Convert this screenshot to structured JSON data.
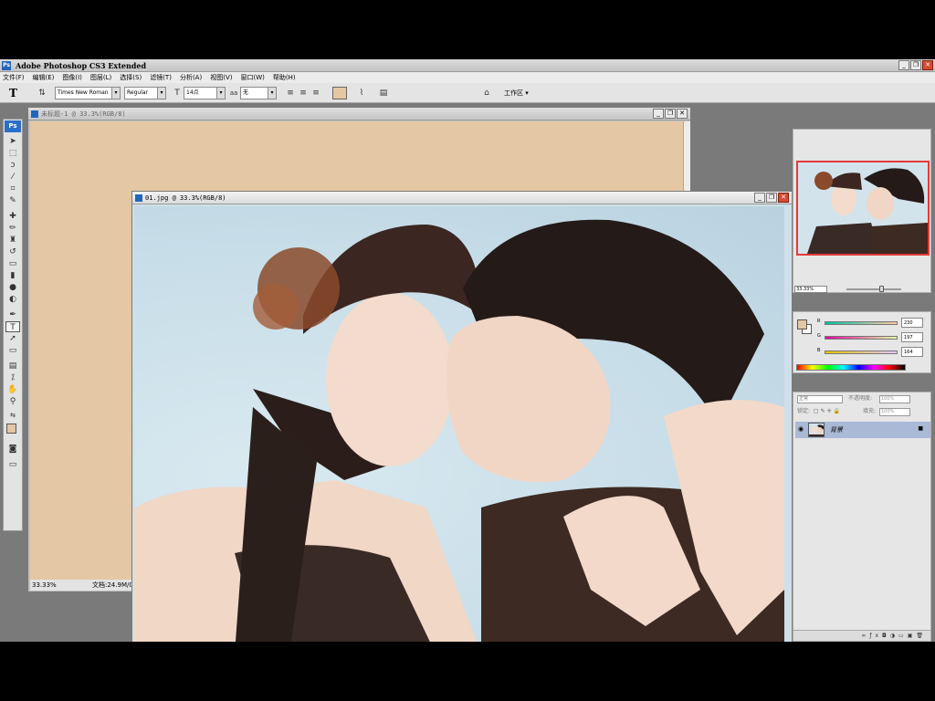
{
  "app": {
    "title": "Adobe Photoshop CS3 Extended",
    "logo_text": "Ps"
  },
  "window_buttons": {
    "minimize": "_",
    "restore": "❐",
    "close": "✕"
  },
  "menu": [
    "文件(F)",
    "编辑(E)",
    "图像(I)",
    "图层(L)",
    "选择(S)",
    "滤镜(T)",
    "分析(A)",
    "视图(V)",
    "窗口(W)",
    "帮助(H)"
  ],
  "options": {
    "tool_glyph": "T",
    "font_family": "Times New Roman",
    "font_style": "Regular",
    "font_size": "14点",
    "aa_label": "aa",
    "antialias": "无",
    "workspace": "工作区",
    "text_color": "#e4c7a3"
  },
  "doc1": {
    "title": "未标题-1 @ 33.3%(RGB/8)",
    "zoom": "33.33%",
    "doc_size": "文档:24.9M/0",
    "canvas_color": "#e4c7a3"
  },
  "doc2": {
    "title": "01.jpg @ 33.3%(RGB/8)"
  },
  "navigator": {
    "zoom": "33.33%"
  },
  "color_panel": {
    "fg_color": "#e4c7a3",
    "r_label": "R",
    "r_value": "230",
    "g_label": "G",
    "g_value": "197",
    "b_label": "B",
    "b_value": "164"
  },
  "layers": {
    "blend_mode": "正常",
    "opacity_label": "不透明度:",
    "opacity": "100%",
    "lock_label": "锁定:",
    "fill_label": "填充:",
    "fill": "100%",
    "layer_name": "背景"
  },
  "icons": {
    "toolbox": [
      "move-icon",
      "marquee-icon",
      "lasso-icon",
      "magic-wand-icon",
      "crop-icon",
      "slice-icon",
      "healing-icon",
      "brush-icon",
      "stamp-icon",
      "history-brush-icon",
      "eraser-icon",
      "gradient-icon",
      "blur-icon",
      "dodge-icon",
      "pen-icon",
      "type-icon",
      "path-select-icon",
      "shape-icon",
      "notes-icon",
      "eyedropper-icon",
      "hand-icon",
      "zoom-icon"
    ]
  }
}
